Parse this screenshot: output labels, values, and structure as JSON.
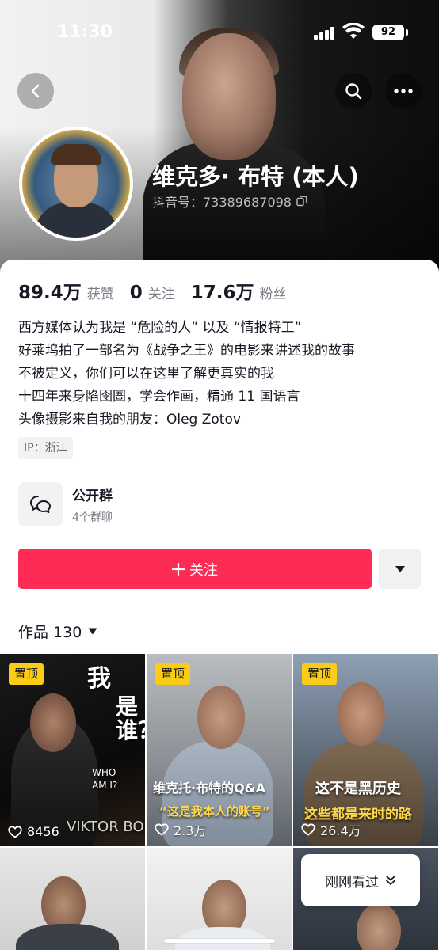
{
  "status_bar": {
    "time": "11:30",
    "battery": "92"
  },
  "profile": {
    "name": "维克多· 布特 (本人)",
    "douyin_id": "抖音号：73389687098",
    "stats": [
      {
        "value": "89.4万",
        "label": "获赞"
      },
      {
        "value": "0",
        "label": "关注"
      },
      {
        "value": "17.6万",
        "label": "粉丝"
      }
    ],
    "bio": [
      "西方媒体认为我是 “危险的人” 以及 “情报特工”",
      "好莱坞拍了一部名为《战争之王》的电影来讲述我的故事",
      "不被定义，你们可以在这里了解更真实的我",
      "十四年来身陷囹圄，学会作画，精通 11 国语言",
      "头像摄影来自我的朋友：Oleg Zotov"
    ],
    "ip_location": "IP：浙江"
  },
  "group": {
    "title": "公开群",
    "subtitle": "4个群聊"
  },
  "actions": {
    "follow_label": "关注"
  },
  "works": {
    "tab_label": "作品 130",
    "pin_label": "置顶",
    "videos": [
      {
        "likes": "8456",
        "overlay_a": "我",
        "overlay_b": "是谁？",
        "overlay_c": "WHO AM I?",
        "overlay_d": "VIKTOR BOUT"
      },
      {
        "likes": "2.3万",
        "overlay_a": "维克托·布特的Q&A",
        "overlay_b": "“这是我本人的账号”"
      },
      {
        "likes": "26.4万",
        "overlay_a": "这不是黑历史",
        "overlay_b": "这些都是来时的路"
      }
    ]
  },
  "recent_button": {
    "label": "刚刚看过"
  },
  "colors": {
    "accent": "#fe2c55",
    "pin_badge": "#facc15"
  }
}
